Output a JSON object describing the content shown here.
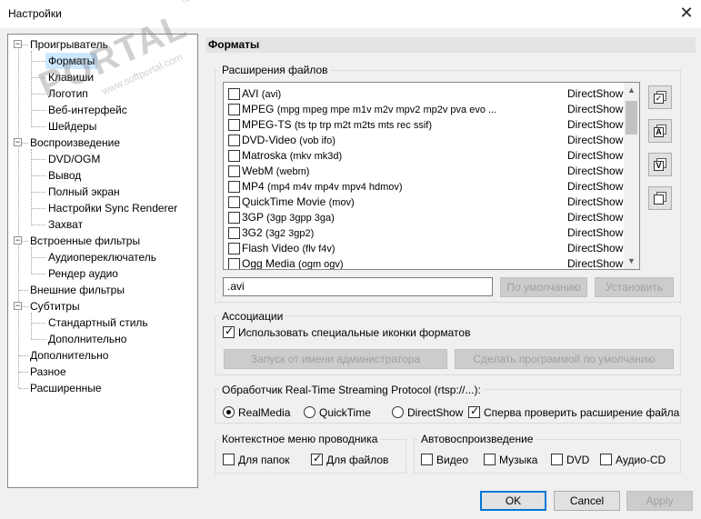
{
  "window": {
    "title": "Настройки",
    "close_glyph": "✕"
  },
  "tree": {
    "nodes": [
      {
        "label": "Проигрыватель",
        "level": 0,
        "expandable": true
      },
      {
        "label": "Форматы",
        "level": 1,
        "selected": true
      },
      {
        "label": "Клавиши",
        "level": 1
      },
      {
        "label": "Логотип",
        "level": 1
      },
      {
        "label": "Веб-интерфейс",
        "level": 1
      },
      {
        "label": "Шейдеры",
        "level": 1
      },
      {
        "label": "Воспроизведение",
        "level": 0,
        "expandable": true
      },
      {
        "label": "DVD/OGM",
        "level": 1
      },
      {
        "label": "Вывод",
        "level": 1
      },
      {
        "label": "Полный экран",
        "level": 1
      },
      {
        "label": "Настройки Sync Renderer",
        "level": 1
      },
      {
        "label": "Захват",
        "level": 1
      },
      {
        "label": "Встроенные фильтры",
        "level": 0,
        "expandable": true
      },
      {
        "label": "Аудиопереключатель",
        "level": 1
      },
      {
        "label": "Рендер аудио",
        "level": 1
      },
      {
        "label": "Внешние фильтры",
        "level": 0
      },
      {
        "label": "Субтитры",
        "level": 0,
        "expandable": true
      },
      {
        "label": "Стандартный стиль",
        "level": 1
      },
      {
        "label": "Дополнительно",
        "level": 1
      },
      {
        "label": "Дополнительно",
        "level": 0
      },
      {
        "label": "Разное",
        "level": 0
      },
      {
        "label": "Расширенные",
        "level": 0
      }
    ]
  },
  "page": {
    "header": "Форматы",
    "extensions": {
      "group_label": "Расширения файлов",
      "files": [
        {
          "name": "AVI",
          "ext": "(avi)",
          "module": "DirectShow",
          "checked": false
        },
        {
          "name": "MPEG",
          "ext": "(mpg mpeg mpe m1v m2v mpv2 mp2v pva evo ...",
          "module": "DirectShow",
          "checked": false
        },
        {
          "name": "MPEG-TS",
          "ext": "(ts tp trp m2t m2ts mts rec ssif)",
          "module": "DirectShow",
          "checked": false
        },
        {
          "name": "DVD-Video",
          "ext": "(vob ifo)",
          "module": "DirectShow",
          "checked": false
        },
        {
          "name": "Matroska",
          "ext": "(mkv mk3d)",
          "module": "DirectShow",
          "checked": false
        },
        {
          "name": "WebM",
          "ext": "(webm)",
          "module": "DirectShow",
          "checked": false
        },
        {
          "name": "MP4",
          "ext": "(mp4 m4v mp4v mpv4 hdmov)",
          "module": "DirectShow",
          "checked": false
        },
        {
          "name": "QuickTime Movie",
          "ext": "(mov)",
          "module": "DirectShow",
          "checked": false
        },
        {
          "name": "3GP",
          "ext": "(3gp 3gpp 3ga)",
          "module": "DirectShow",
          "checked": false
        },
        {
          "name": "3G2",
          "ext": "(3g2 3gp2)",
          "module": "DirectShow",
          "checked": false
        },
        {
          "name": "Flash Video",
          "ext": "(flv f4v)",
          "module": "DirectShow",
          "checked": false
        },
        {
          "name": "Ogg Media",
          "ext": "(ogm ogv)",
          "module": "DirectShow",
          "checked": false
        }
      ],
      "ext_value": ".avi",
      "default_button": "По умолчанию",
      "set_button": "Установить",
      "side_buttons": [
        "select-all",
        "audio",
        "video",
        "none"
      ],
      "side_icon_letters": [
        "✓",
        "A",
        "V",
        ""
      ]
    },
    "associations": {
      "group_label": "Ассоциации",
      "special_icons_label": "Использовать специальные иконки форматов",
      "special_icons_checked": true,
      "run_as_admin_button": "Запуск от имени администратора",
      "make_default_button": "Сделать программой по умолчанию"
    },
    "rtsp": {
      "group_label": "Обработчик Real-Time Streaming Protocol (rtsp://...):",
      "options": [
        "RealMedia",
        "QuickTime",
        "DirectShow"
      ],
      "selected": "RealMedia",
      "check_ext_label": "Сперва проверить расширение файла",
      "check_ext_checked": true
    },
    "context_menu": {
      "group_label": "Контекстное меню проводника",
      "folders_label": "Для папок",
      "folders_checked": false,
      "files_label": "Для файлов",
      "files_checked": true
    },
    "autoplay": {
      "group_label": "Автовоспроизведение",
      "video_label": "Видео",
      "video_checked": false,
      "music_label": "Музыка",
      "music_checked": false,
      "dvd_label": "DVD",
      "dvd_checked": false,
      "audiocd_label": "Аудио-CD",
      "audiocd_checked": false
    }
  },
  "footer": {
    "ok": "OK",
    "cancel": "Cancel",
    "apply": "Apply"
  },
  "watermark": {
    "text": "PORTAL",
    "tm": "™",
    "site": "www.softportal.com"
  },
  "colors": {
    "selection": "#cce8ff",
    "accent": "#0078d7"
  }
}
